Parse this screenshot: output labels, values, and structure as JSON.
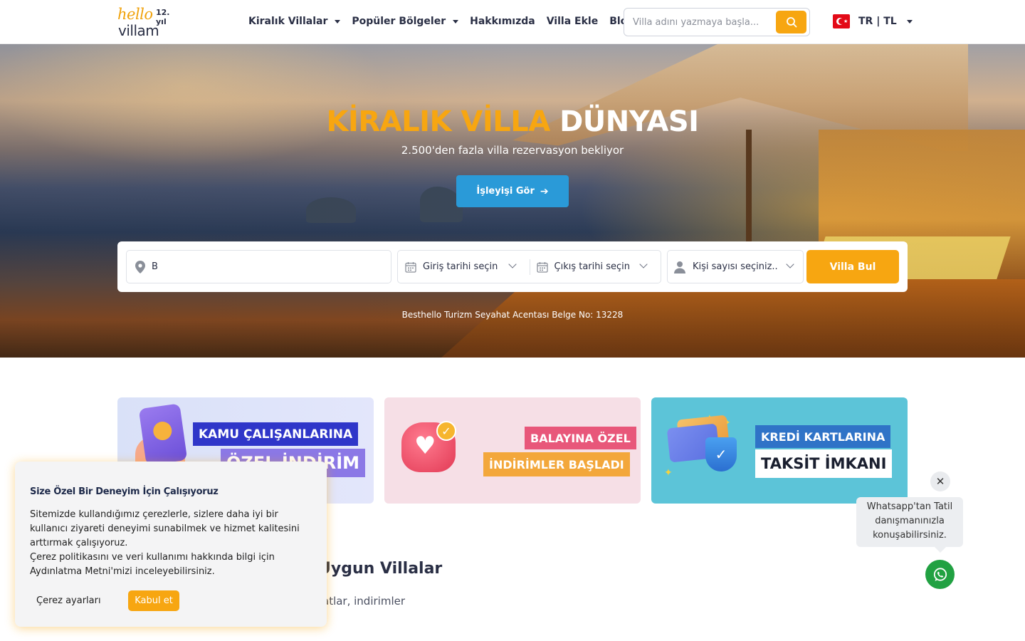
{
  "brand": {
    "logo_top": "hello",
    "logo_bottom": "villam",
    "years_badge": "12. yıl",
    "accent_color": "#f7a611",
    "secondary_color": "#2a9ad8"
  },
  "nav": {
    "items": [
      {
        "label": "Kiralık Villalar",
        "has_dropdown": true
      },
      {
        "label": "Popüler Bölgeler",
        "has_dropdown": true
      },
      {
        "label": "Hakkımızda",
        "has_dropdown": false
      },
      {
        "label": "Villa Ekle",
        "has_dropdown": false
      },
      {
        "label": "Blog",
        "has_dropdown": false
      }
    ]
  },
  "header_search": {
    "placeholder": "Villa adını yazmaya başla...",
    "button_icon": "search-icon"
  },
  "locale": {
    "flag_icon": "turkey-flag-icon",
    "label": "TR | TL"
  },
  "hero": {
    "title_highlight": "KİRALIK VİLLA",
    "title_rest": "DÜNYASI",
    "subtitle": "2.500'den fazla villa rezervasyon bekliyor",
    "cta_label": "İşleyişi Gör",
    "cta_icon": "arrow-right-icon",
    "license_text": "Besthello Turizm Seyahat Acentası Belge No: 13228"
  },
  "booking_search": {
    "location_value": "B",
    "checkin_label": "Giriş tarihi seçin",
    "checkout_label": "Çıkış tarihi seçin",
    "guests_label": "Kişi sayısı seçiniz..",
    "submit_label": "Villa Bul"
  },
  "promos": [
    {
      "line1": "KAMU ÇALIŞANLARINA",
      "line2": "ÖZEL İNDİRİM"
    },
    {
      "line1": "BALAYINA ÖZEL",
      "line2": "İNDİRİMLER BAŞLADI"
    },
    {
      "line1": "KREDİ KARTLARINA",
      "line2": "TAKSİT İMKANI"
    }
  ],
  "section": {
    "title_visible": "Uygun Villalar",
    "subtitle_visible": "atlar, indirimler"
  },
  "cookie": {
    "title": "Size Özel Bir Deneyim İçin Çalışıyoruz",
    "body_line1": "Sitemizde kullandığımız çerezlerle, sizlere daha iyi bir kullanıcı ziyareti deneyimi sunabilmek ve hizmet kalitesini arttırmak çalışıyoruz.",
    "body_line2": "Çerez politikasını ve veri kullanımı hakkında bilgi için Aydınlatma Metni'mizi inceleyebilirsiniz.",
    "settings_label": "Çerez ayarları",
    "accept_label": "Kabul et"
  },
  "whatsapp": {
    "message": "Whatsapp'tan Tatil danışmanınızla konuşabilirsiniz.",
    "close_symbol": "✕",
    "button_icon": "whatsapp-icon"
  }
}
